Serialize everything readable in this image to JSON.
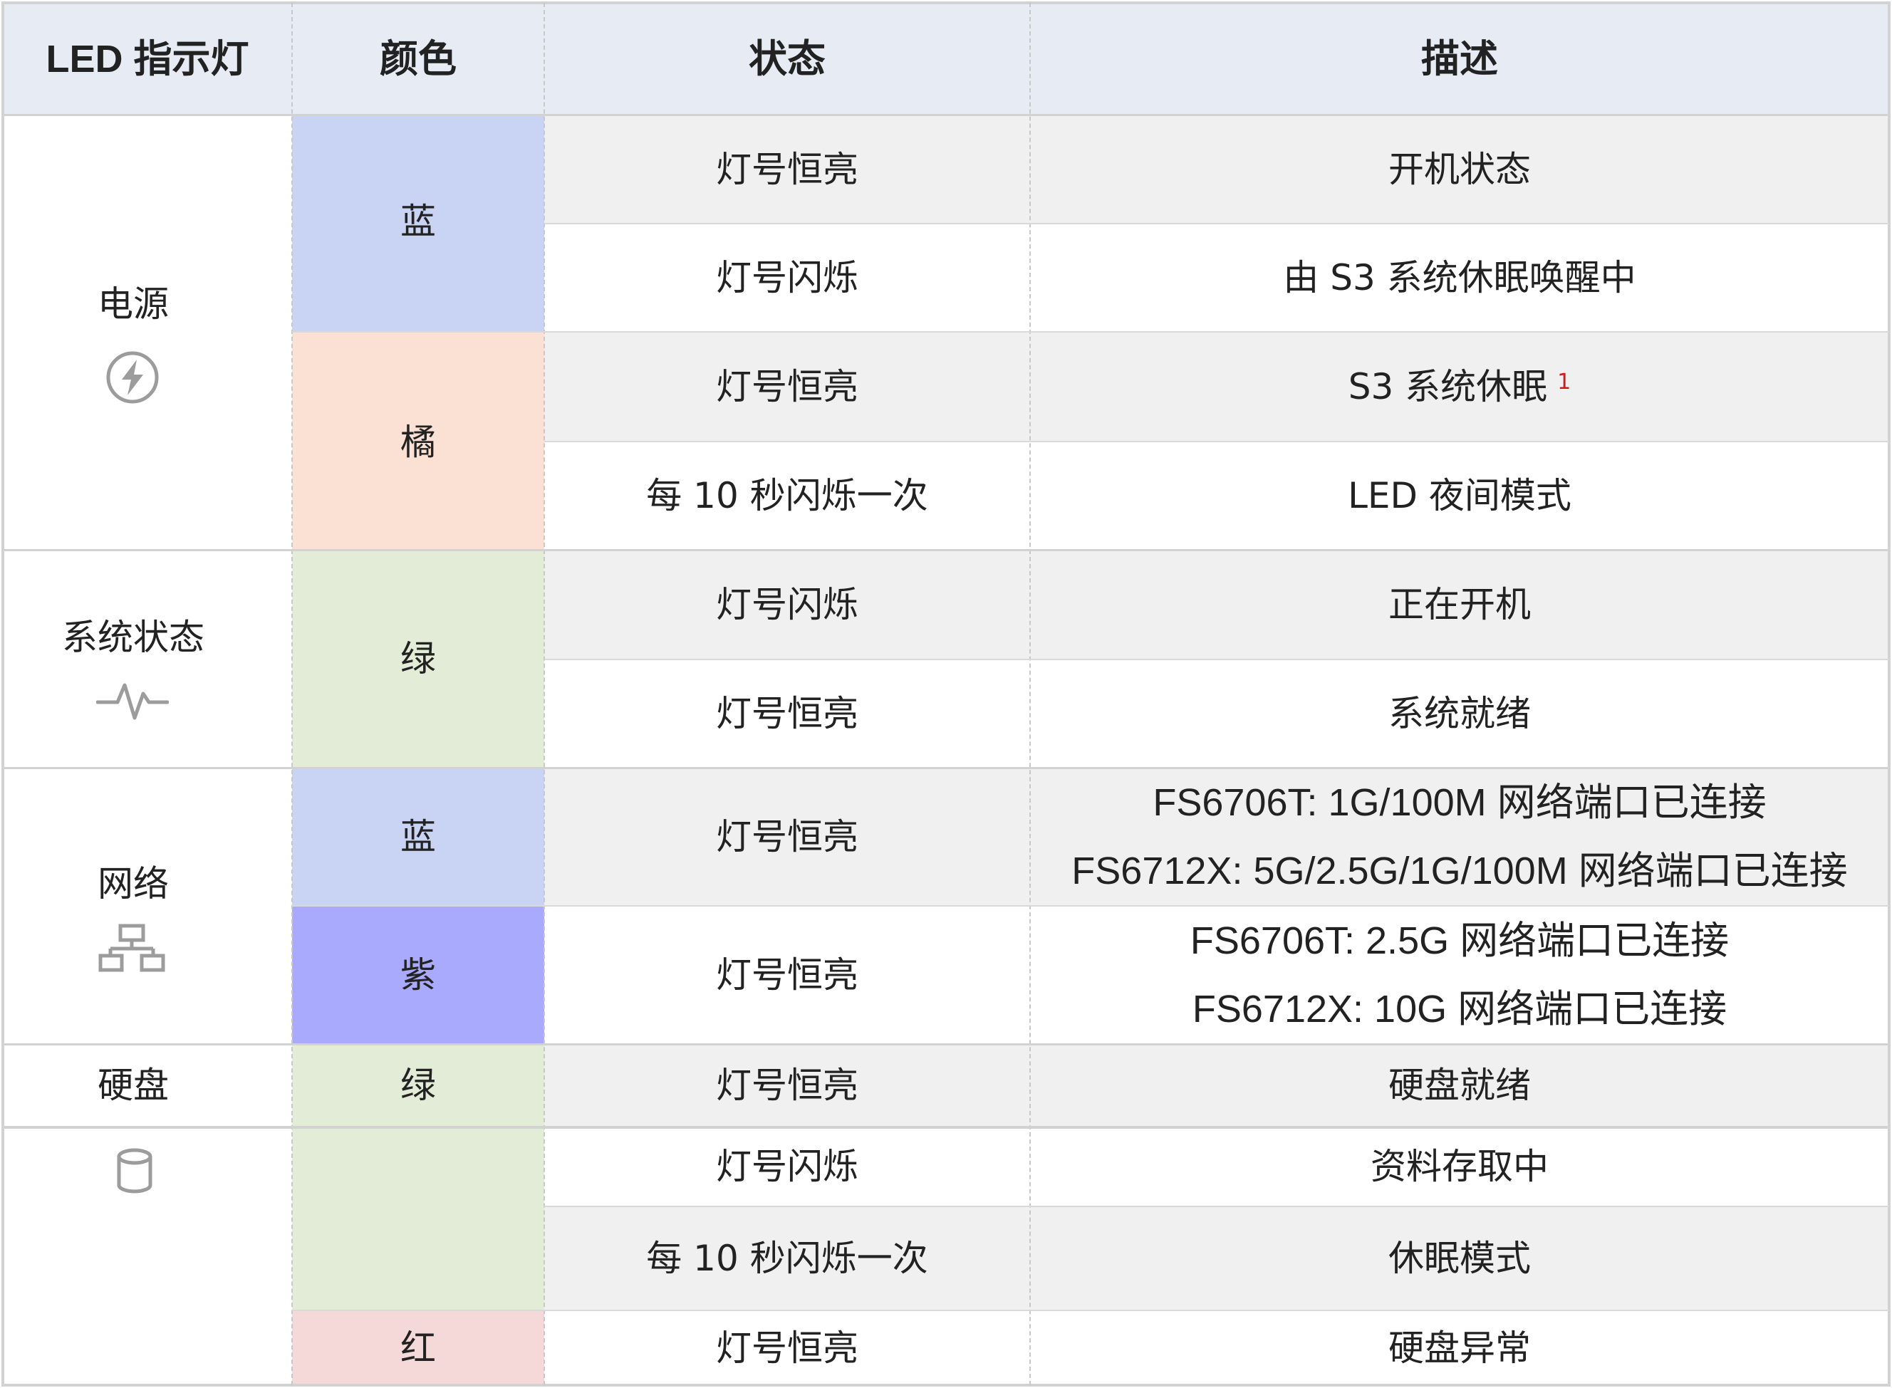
{
  "headers": {
    "led": "LED 指示灯",
    "color": "颜色",
    "status": "状态",
    "description": "描述"
  },
  "indicators": [
    {
      "name": "电源",
      "icon": "power-icon"
    },
    {
      "name": "系统状态",
      "icon": "heartbeat-icon"
    },
    {
      "name": "网络",
      "icon": "network-icon"
    },
    {
      "name": "硬盘",
      "icon": "disk-icon"
    }
  ],
  "colors": {
    "blue": "蓝",
    "orange": "橘",
    "green_sys": "绿",
    "net_blue": "蓝",
    "purple": "紫",
    "green_disk": "绿",
    "red": "红"
  },
  "swatches": {
    "blue": "#c9d3f3",
    "orange": "#fbe1d4",
    "green": "#e2ecd7",
    "purple": "#a9a9fd",
    "red": "#f5d9d8",
    "header": "#e6ebf4",
    "row_gray": "#f0f0f0"
  },
  "rows": [
    {
      "status": "灯号恒亮",
      "desc": "开机状态"
    },
    {
      "status": "灯号闪烁",
      "desc": "由 S3 系统休眠唤醒中"
    },
    {
      "status": "灯号恒亮",
      "desc": "S3 系统休眠",
      "footnote": "1"
    },
    {
      "status": "每 10 秒闪烁一次",
      "desc": "LED 夜间模式"
    },
    {
      "status": "灯号闪烁",
      "desc": "正在开机"
    },
    {
      "status": "灯号恒亮",
      "desc": "系统就绪"
    },
    {
      "status": "灯号恒亮",
      "desc_lines": [
        "FS6706T: 1G/100M 网络端口已连接",
        "FS6712X: 5G/2.5G/1G/100M 网络端口已连接"
      ]
    },
    {
      "status": "灯号恒亮",
      "desc_lines": [
        "FS6706T: 2.5G 网络端口已连接",
        "FS6712X: 10G 网络端口已连接"
      ]
    },
    {
      "status": "灯号恒亮",
      "desc": "硬盘就绪"
    },
    {
      "status": "灯号闪烁",
      "desc": "资料存取中"
    },
    {
      "status": "每 10 秒闪烁一次",
      "desc": "休眠模式"
    },
    {
      "status": "灯号恒亮",
      "desc": "硬盘异常"
    }
  ]
}
